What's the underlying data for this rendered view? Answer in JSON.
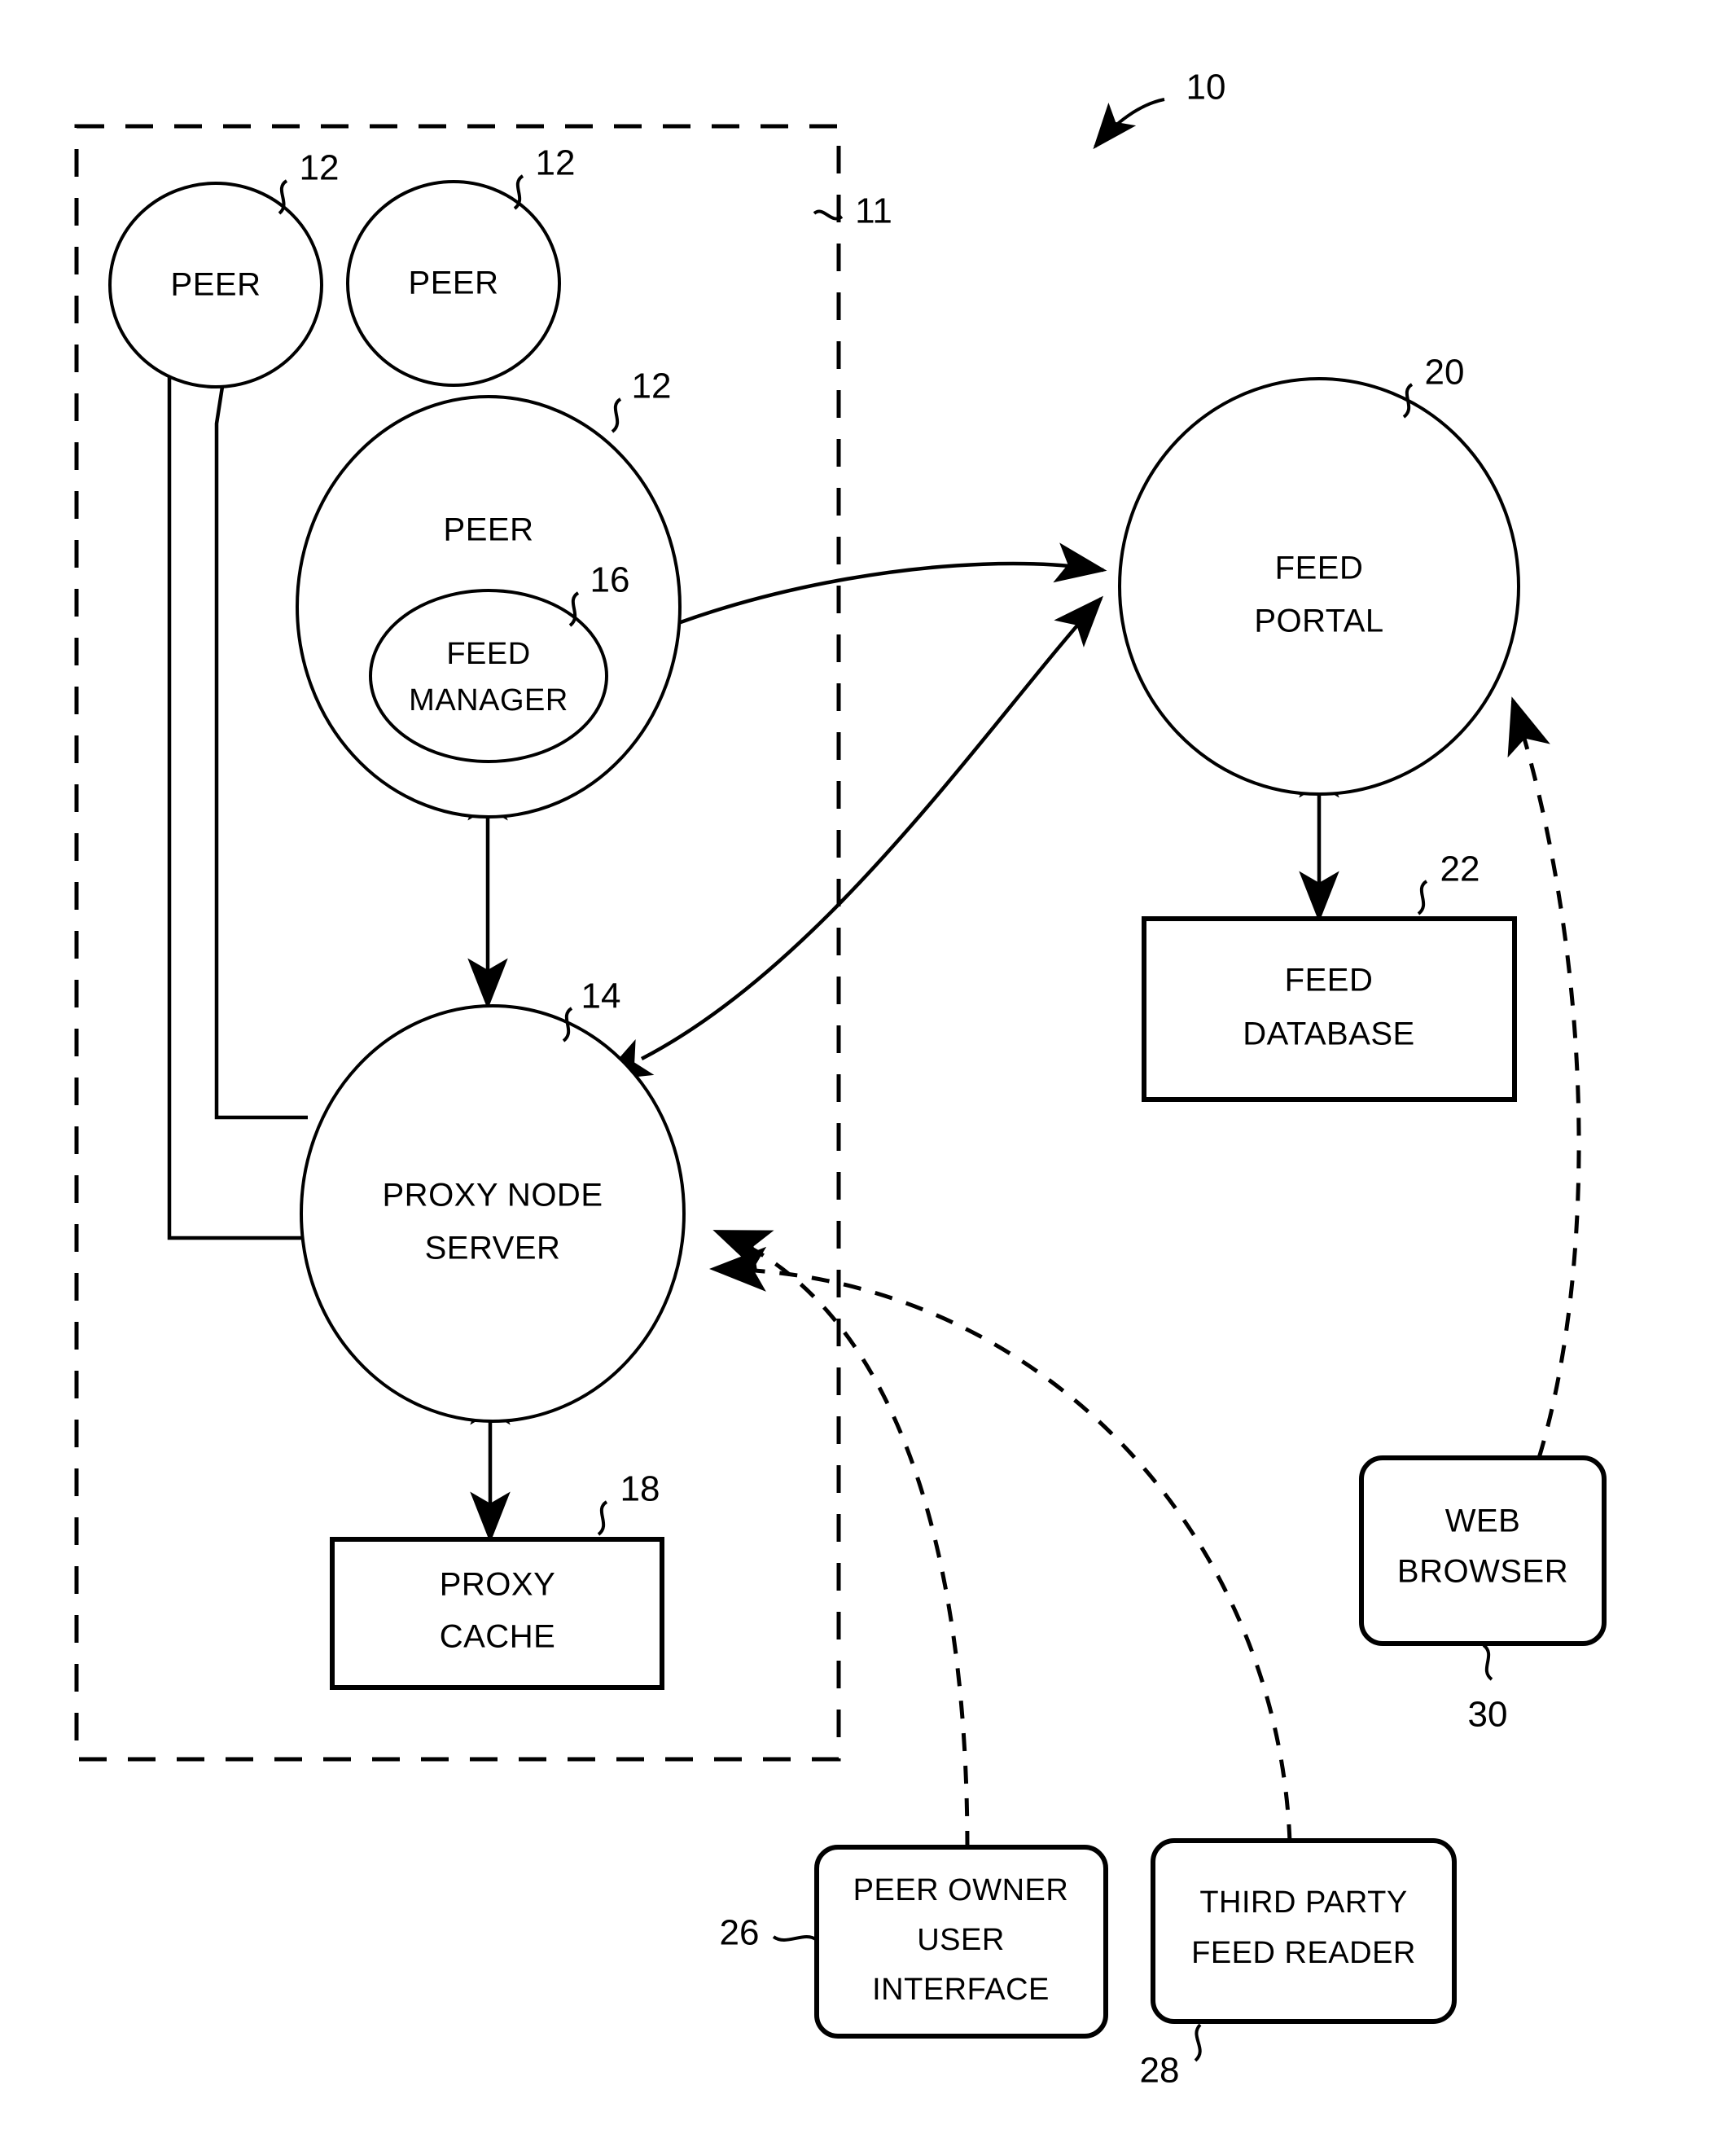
{
  "figure": {
    "type": "patent-diagram",
    "system_reference": "10",
    "boundary_reference": "11",
    "background_color": "#ffffff",
    "line_color": "#000000"
  },
  "nodes": {
    "peer_a": {
      "label": "PEER",
      "ref": "12",
      "shape": "circle"
    },
    "peer_b": {
      "label": "PEER",
      "ref": "12",
      "shape": "circle"
    },
    "peer_main": {
      "label": "PEER",
      "ref": "12",
      "shape": "circle"
    },
    "feed_manager": {
      "label_line1": "FEED",
      "label_line2": "MANAGER",
      "ref": "16",
      "shape": "ellipse"
    },
    "proxy_node_server": {
      "label_line1": "PROXY NODE",
      "label_line2": "SERVER",
      "ref": "14",
      "shape": "circle"
    },
    "proxy_cache": {
      "label_line1": "PROXY",
      "label_line2": "CACHE",
      "ref": "18",
      "shape": "rectangle"
    },
    "feed_portal": {
      "label_line1": "FEED",
      "label_line2": "PORTAL",
      "ref": "20",
      "shape": "circle"
    },
    "feed_database": {
      "label_line1": "FEED",
      "label_line2": "DATABASE",
      "ref": "22",
      "shape": "rectangle"
    },
    "web_browser": {
      "label_line1": "WEB",
      "label_line2": "BROWSER",
      "ref": "30",
      "shape": "rounded-rectangle"
    },
    "peer_owner_ui": {
      "label_line1": "PEER OWNER",
      "label_line2": "USER",
      "label_line3": "INTERFACE",
      "ref": "26",
      "shape": "rounded-rectangle"
    },
    "third_party_reader": {
      "label_line1": "THIRD PARTY",
      "label_line2": "FEED READER",
      "ref": "28",
      "shape": "rounded-rectangle"
    }
  },
  "connections": [
    {
      "from": "peer_a",
      "to": "proxy_node_server",
      "style": "solid",
      "arrows": "none"
    },
    {
      "from": "peer_b",
      "to": "proxy_node_server",
      "style": "solid",
      "arrows": "none"
    },
    {
      "from": "peer_main",
      "to": "proxy_node_server",
      "style": "solid",
      "arrows": "both"
    },
    {
      "from": "feed_manager",
      "to": "feed_portal",
      "style": "solid",
      "arrows": "to"
    },
    {
      "from": "proxy_node_server",
      "to": "feed_portal",
      "style": "solid",
      "arrows": "both"
    },
    {
      "from": "proxy_node_server",
      "to": "proxy_cache",
      "style": "solid",
      "arrows": "both"
    },
    {
      "from": "feed_portal",
      "to": "feed_database",
      "style": "solid",
      "arrows": "both"
    },
    {
      "from": "web_browser",
      "to": "feed_portal",
      "style": "dashed",
      "arrows": "to"
    },
    {
      "from": "peer_owner_ui",
      "to": "proxy_node_server",
      "style": "dashed",
      "arrows": "to"
    },
    {
      "from": "third_party_reader",
      "to": "proxy_node_server",
      "style": "dashed",
      "arrows": "to"
    }
  ]
}
